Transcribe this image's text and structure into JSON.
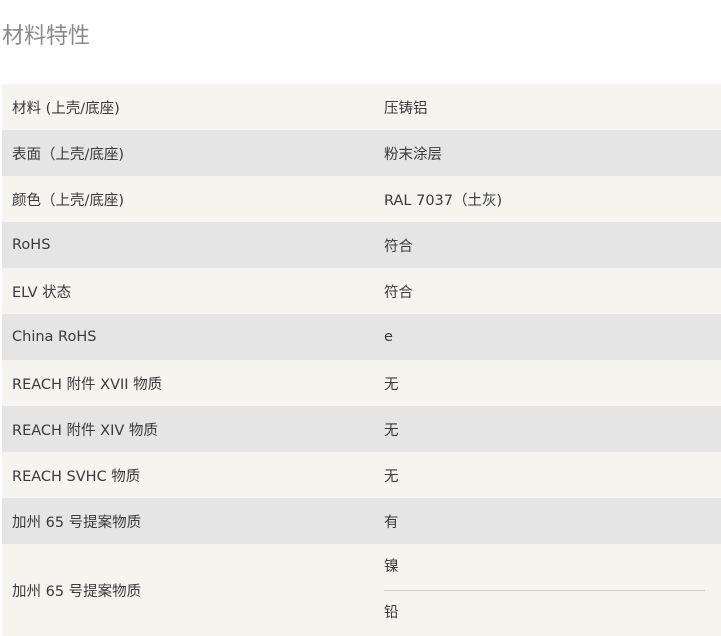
{
  "section_title": "材料特性",
  "rows": [
    {
      "label": "材料 (上壳/底座)",
      "value": "压铸铝"
    },
    {
      "label": "表面（上壳/底座)",
      "value": "粉末涂层"
    },
    {
      "label": "颜色（上壳/底座)",
      "value": "RAL 7037（土灰)"
    },
    {
      "label": "RoHS",
      "value": "符合"
    },
    {
      "label": "ELV 状态",
      "value": "符合"
    },
    {
      "label": "China RoHS",
      "value": "e"
    },
    {
      "label": "REACH 附件 XVII 物质",
      "value": "无"
    },
    {
      "label": "REACH 附件 XIV 物质",
      "value": "无"
    },
    {
      "label": "REACH SVHC 物质",
      "value": "无"
    },
    {
      "label": "加州 65 号提案物质",
      "value": "有"
    },
    {
      "label": "加州 65 号提案物质",
      "values": [
        "镍",
        "铅"
      ]
    }
  ]
}
